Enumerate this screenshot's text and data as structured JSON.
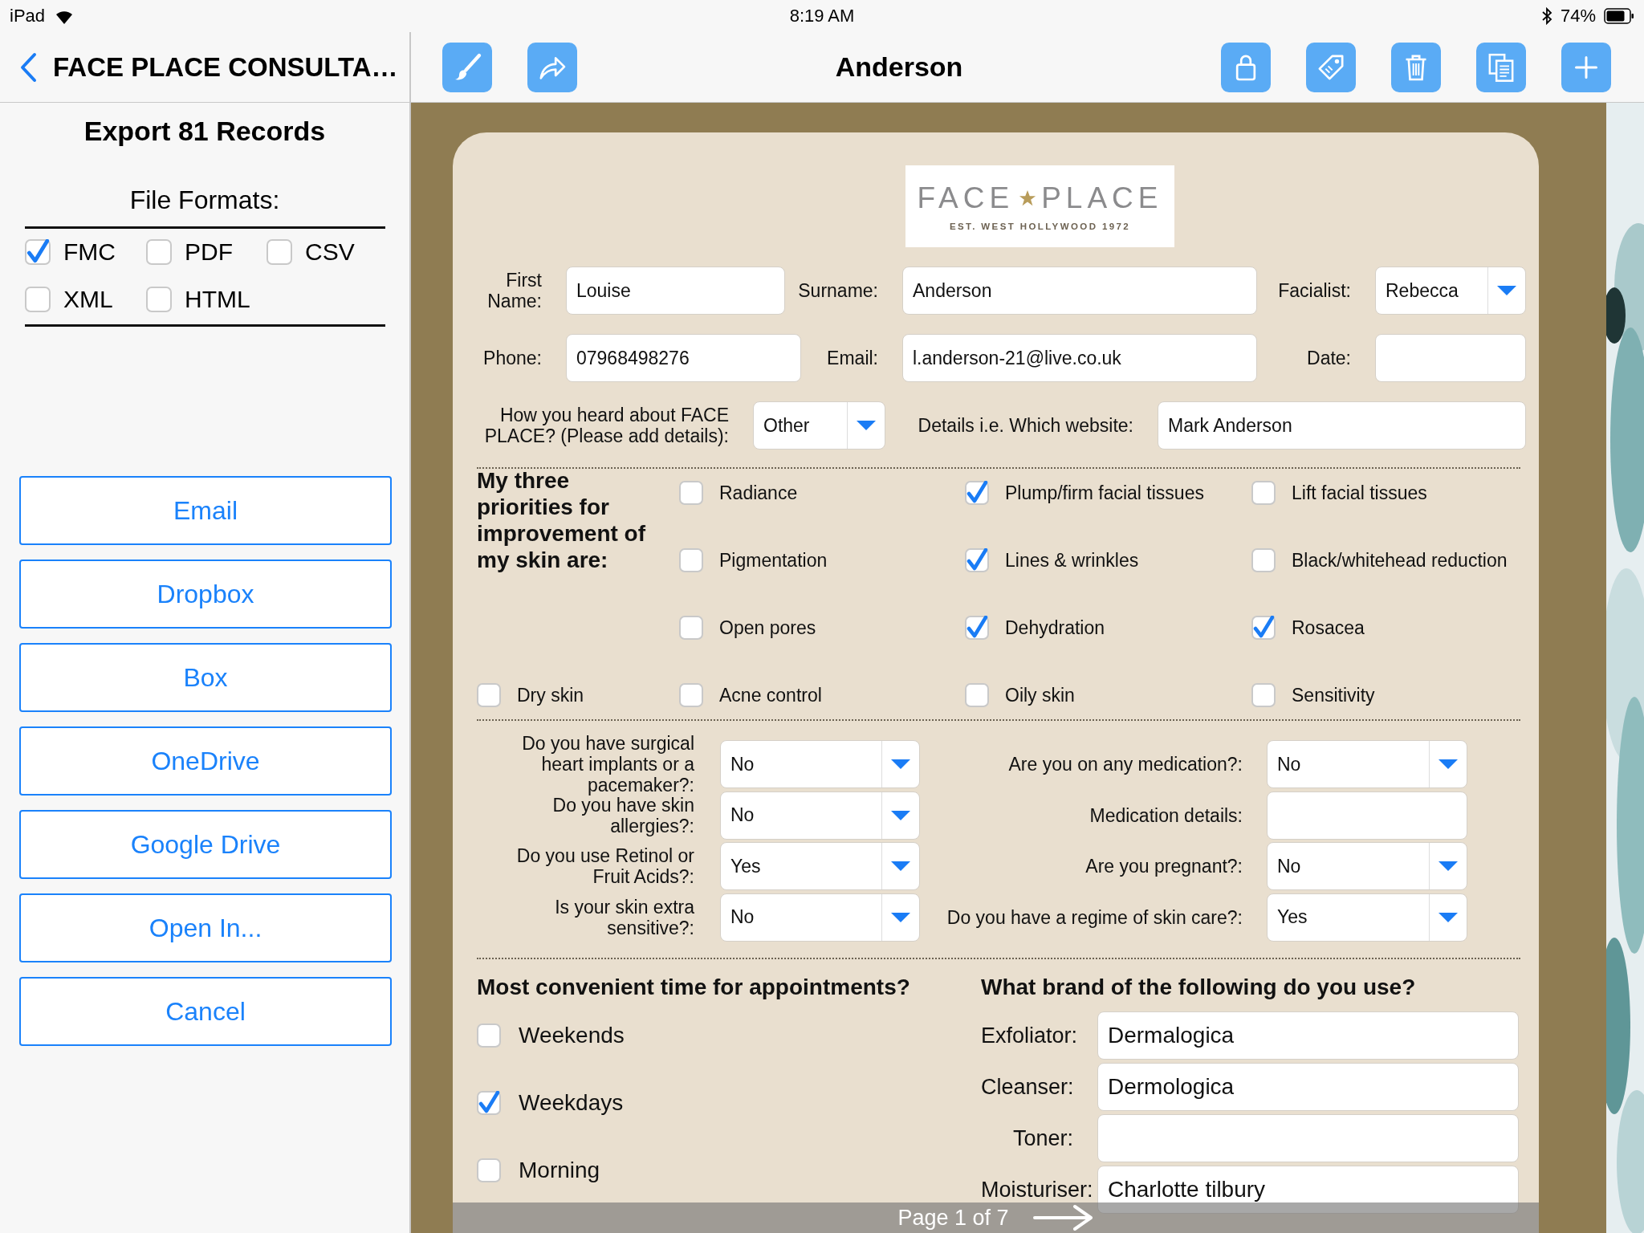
{
  "status_bar": {
    "device": "iPad",
    "time": "8:19 AM",
    "battery": "74%"
  },
  "sidebar": {
    "back_title": "FACE PLACE CONSULTA…",
    "heading": "Export 81 Records",
    "formats_title": "File Formats:",
    "formats": [
      {
        "label": "FMC",
        "checked": true
      },
      {
        "label": "PDF",
        "checked": false
      },
      {
        "label": "CSV",
        "checked": false
      },
      {
        "label": "XML",
        "checked": false
      },
      {
        "label": "HTML",
        "checked": false
      }
    ],
    "buttons": [
      "Email",
      "Dropbox",
      "Box",
      "OneDrive",
      "Google Drive",
      "Open In...",
      "Cancel"
    ]
  },
  "toolbar": {
    "title": "Anderson"
  },
  "form": {
    "logo": {
      "left": "FACE",
      "right": "PLACE",
      "tagline": "EST. WEST HOLLYWOOD 1972"
    },
    "details": [
      [
        {
          "label": "First Name:",
          "kind": "text",
          "value": "Louise"
        },
        {
          "label": "Surname:",
          "kind": "text",
          "value": "Anderson"
        },
        {
          "label": "Facialist:",
          "kind": "dropdown",
          "value": "Rebecca"
        }
      ],
      [
        {
          "label": "Phone:",
          "kind": "text",
          "value": "07968498276"
        },
        {
          "label": "Email:",
          "kind": "text",
          "value": "l.anderson-21@live.co.uk"
        },
        {
          "label": "Date:",
          "kind": "text"
        }
      ],
      [
        {
          "label": "How you heard about FACE PLACE? (Please add details):",
          "kind": "dropdown",
          "value": "Other"
        },
        {
          "label": "Details i.e. Which website:",
          "kind": "text",
          "value": "Mark Anderson"
        }
      ]
    ],
    "priorities": {
      "heading": "My three priorities for improvement of my skin are:",
      "options": [
        {
          "label": "Radiance",
          "checked": false
        },
        {
          "label": "Plump/firm facial tissues",
          "checked": true
        },
        {
          "label": "Lift facial tissues",
          "checked": false
        },
        {
          "label": "Pigmentation",
          "checked": false
        },
        {
          "label": "Lines & wrinkles",
          "checked": true
        },
        {
          "label": "Black/whitehead reduction",
          "checked": false
        },
        {
          "label": "Open pores",
          "checked": false
        },
        {
          "label": "Dehydration",
          "checked": true
        },
        {
          "label": "Rosacea",
          "checked": true
        },
        {
          "label": "Dry skin",
          "checked": false
        },
        {
          "label": "Acne control",
          "checked": false
        },
        {
          "label": "Oily skin",
          "checked": false
        },
        {
          "label": "Sensitivity",
          "checked": false
        }
      ]
    },
    "questions": [
      {
        "label": "Do you have surgical heart implants or a pacemaker?:",
        "kind": "dropdown",
        "value": "No"
      },
      {
        "label": "Are you on any medication?:",
        "kind": "dropdown",
        "value": "No"
      },
      {
        "label": "Do you have skin allergies?:",
        "kind": "dropdown",
        "value": "No"
      },
      {
        "label": "Medication details:",
        "kind": "text"
      },
      {
        "label": "Do you use Retinol or Fruit Acids?:",
        "kind": "dropdown",
        "value": "Yes"
      },
      {
        "label": "Are you pregnant?:",
        "kind": "dropdown",
        "value": "No"
      },
      {
        "label": "Is your skin extra sensitive?:",
        "kind": "dropdown",
        "value": "No"
      },
      {
        "label": "Do you have a regime of skin care?:",
        "kind": "dropdown",
        "value": "Yes"
      }
    ],
    "appointments": {
      "heading": "Most convenient time for appointments?",
      "options": [
        {
          "label": "Weekends",
          "checked": false
        },
        {
          "label": "Weekdays",
          "checked": true
        },
        {
          "label": "Morning",
          "checked": false
        }
      ]
    },
    "brands": {
      "heading": "What brand of the following do you use?",
      "fields": [
        {
          "label": "Exfoliator:",
          "value": "Dermalogica"
        },
        {
          "label": "Cleanser:",
          "value": "Dermologica"
        },
        {
          "label": "Toner:"
        },
        {
          "label": "Moisturiser:",
          "value": "Charlotte tilbury"
        }
      ]
    },
    "pager": "Page 1 of 7"
  }
}
